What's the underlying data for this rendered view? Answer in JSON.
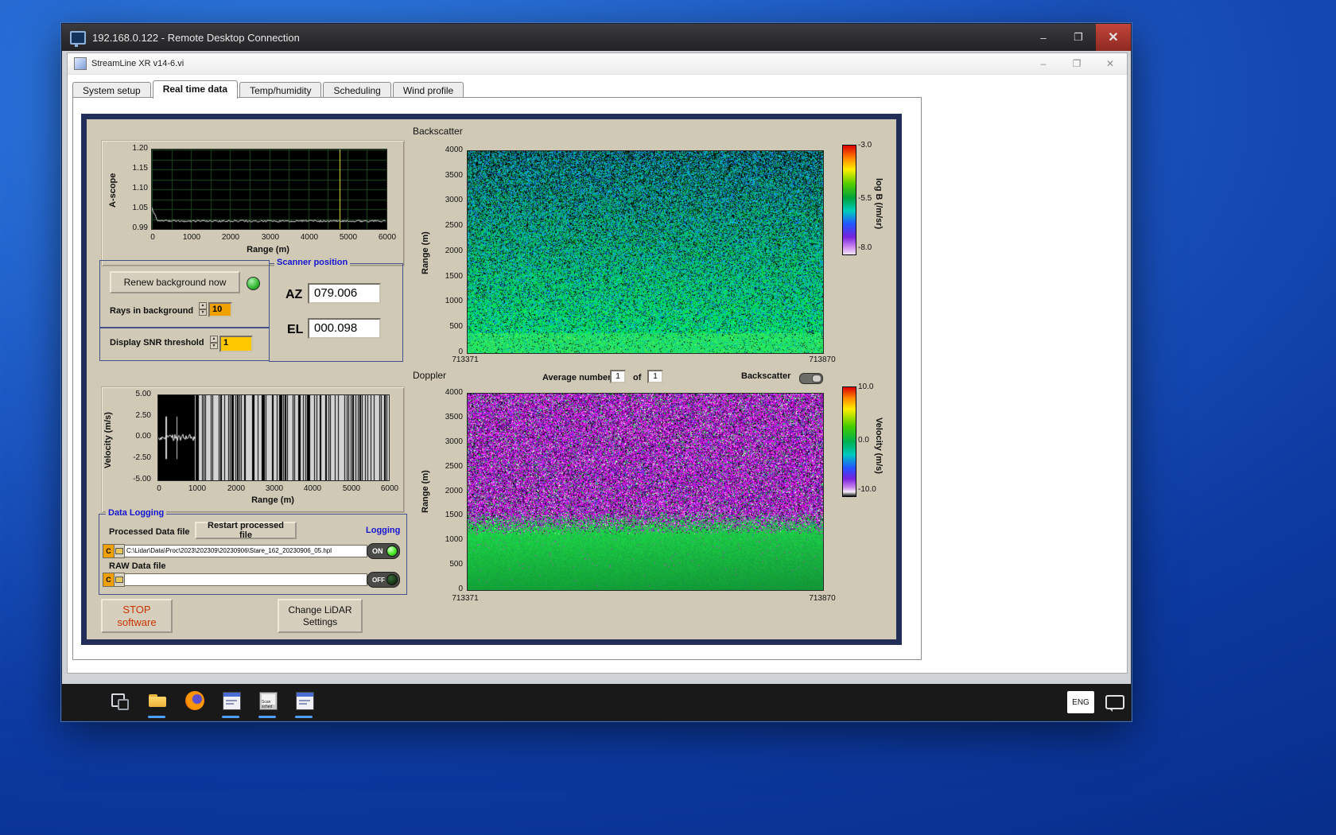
{
  "rdp": {
    "title": "192.168.0.122 - Remote Desktop Connection",
    "buttons": {
      "minimize": "–",
      "maximize": "❐",
      "close": "✕"
    }
  },
  "app": {
    "title": "StreamLine XR v14-6.vi",
    "buttons": {
      "minimize": "–",
      "restore": "❐",
      "close": "✕"
    },
    "tabs": [
      "System setup",
      "Real time data",
      "Temp/humidity",
      "Scheduling",
      "Wind profile"
    ]
  },
  "ascope": {
    "ylabel": "A-scope",
    "xlabel": "Range (m)",
    "yticks": [
      "1.20",
      "1.15",
      "1.10",
      "1.05",
      "0.99"
    ],
    "xticks": [
      "0",
      "1000",
      "2000",
      "3000",
      "4000",
      "5000",
      "6000"
    ]
  },
  "background_ctrl": {
    "renew_button": "Renew background now",
    "rays_label": "Rays in background",
    "rays_value": "10",
    "snr_label": "Display SNR threshold",
    "snr_value": "1"
  },
  "scanner": {
    "title": "Scanner position",
    "az_label": "AZ",
    "az_value": "079.006",
    "el_label": "EL",
    "el_value": "000.098"
  },
  "backscatter": {
    "title": "Backscatter",
    "ylabel": "Range (m)",
    "yticks": [
      "4000",
      "3500",
      "3000",
      "2500",
      "2000",
      "1500",
      "1000",
      "500",
      "0"
    ],
    "xstart": "713371",
    "xend": "713870",
    "cb_label": "log B (/m/sr)",
    "cb_ticks": [
      "-3.0",
      "-5.5",
      "-8.0"
    ]
  },
  "doppler": {
    "title": "Doppler",
    "avg_label": "Average number",
    "avg1": "1",
    "of_label": "of",
    "avg2": "1",
    "toggle_label": "Backscatter",
    "ylabel": "Range (m)",
    "yticks": [
      "4000",
      "3500",
      "3000",
      "2500",
      "2000",
      "1500",
      "1000",
      "500",
      "0"
    ],
    "xstart": "713371",
    "xend": "713870",
    "cb_label": "Velocity (m/s)",
    "cb_ticks": [
      "10.0",
      "0.0",
      "-10.0"
    ]
  },
  "velocity": {
    "ylabel": "Velocity (m/s)",
    "xlabel": "Range (m)",
    "yticks": [
      "5.00",
      "2.50",
      "0.00",
      "-2.50",
      "-5.00"
    ],
    "xticks": [
      "0",
      "1000",
      "2000",
      "3000",
      "4000",
      "5000",
      "6000"
    ]
  },
  "logging": {
    "title": "Data Logging",
    "processed_label": "Processed Data file",
    "restart_button": "Restart processed file",
    "logging_label": "Logging",
    "drive": "C",
    "processed_path": "C:\\Lidar\\Data\\Proc\\2023\\202309\\20230906\\Stare_162_20230906_05.hpl",
    "on_label": "ON",
    "raw_label": "RAW Data file",
    "raw_path": "",
    "off_label": "OFF"
  },
  "actions": {
    "stop_line1": "STOP",
    "stop_line2": "software",
    "change_line1": "Change LiDAR",
    "change_line2": "Settings"
  },
  "taskbar": {
    "lang": "ENG"
  },
  "colors": {
    "panel_navy": "#222d58",
    "panel_tan": "#d0c9b6",
    "label_blue": "#1414d2",
    "value_orange": "#f0a000",
    "value_yellow": "#ffc800",
    "led_green": "#2db82d",
    "taskbar_accent": "#4da0ff"
  }
}
